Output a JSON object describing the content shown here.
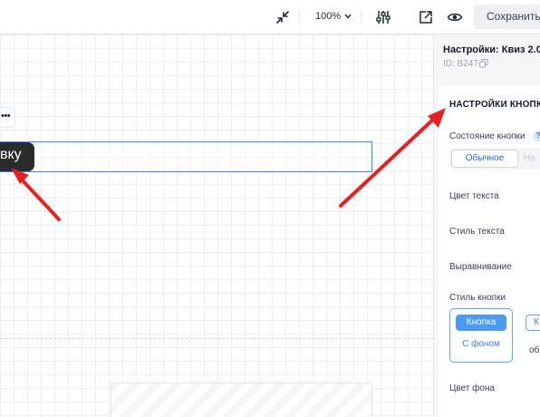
{
  "toolbar": {
    "zoom_label": "100%",
    "save_label": "Сохранить",
    "icons": [
      "collapse-arrows-icon",
      "chevron-down-icon",
      "sliders-icon",
      "external-link-icon",
      "eye-icon"
    ]
  },
  "canvas": {
    "dots_label": "•••",
    "tooltip_text": "вку"
  },
  "panel": {
    "title": "Настройки: Квиз 2.0",
    "id_label": "ID: B247",
    "section_title": "НАСТРОЙКИ КНОПКИ",
    "button_state_label": "Состояние кнопки",
    "help_mark": "?",
    "state_options": [
      "Обычное",
      "На"
    ],
    "text_color_label": "Цвет текста",
    "text_style_label": "Стиль текста",
    "alignment_label": "Выравнивание",
    "button_style_label": "Стиль кнопки",
    "style_options": [
      {
        "pill": "Кнопка",
        "caption": "С фоном"
      },
      {
        "pill": "К",
        "caption": "об"
      }
    ],
    "bg_color_label": "Цвет фона"
  },
  "colors": {
    "accent": "#4b9cf0",
    "selection_border": "#3b82f6",
    "annotation_arrow": "#e8201f",
    "tooltip_bg": "#2b2b2b"
  }
}
